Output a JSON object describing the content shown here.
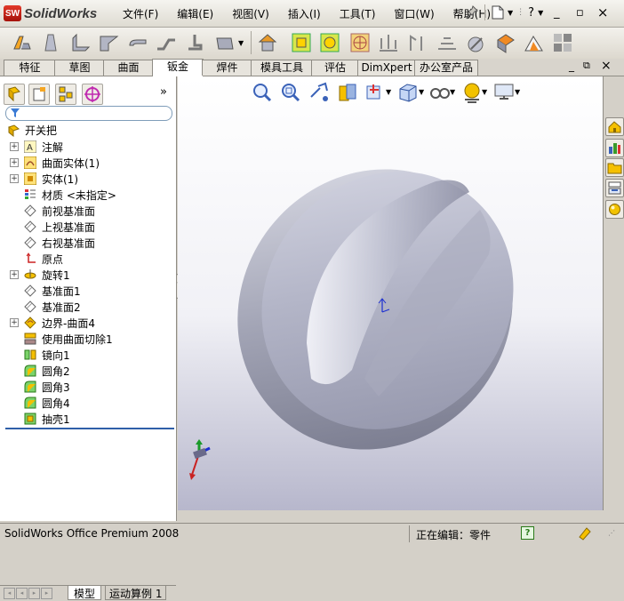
{
  "app": {
    "brand": "SolidWorks",
    "logo_text": "SW"
  },
  "menu": [
    "文件(F)",
    "编辑(E)",
    "视图(V)",
    "插入(I)",
    "工具(T)",
    "窗口(W)",
    "帮助(H)"
  ],
  "quick_access": {
    "help_glyph": "?"
  },
  "window_buttons": {
    "minimize": "_",
    "restore": "▫",
    "close": "×"
  },
  "command_tabs": [
    {
      "label": "特征"
    },
    {
      "label": "草图"
    },
    {
      "label": "曲面"
    },
    {
      "label": "钣金"
    },
    {
      "label": "焊件"
    },
    {
      "label": "模具工具"
    },
    {
      "label": "评估"
    },
    {
      "label": "DimXpert"
    },
    {
      "label": "办公室产品"
    }
  ],
  "active_tab": "钣金",
  "feature_tree": {
    "root": "开关把",
    "items": [
      {
        "label": "注解",
        "expandable": true,
        "icon": "annotation-icon"
      },
      {
        "label": "曲面实体(1)",
        "expandable": true,
        "icon": "surface-bodies-icon"
      },
      {
        "label": "实体(1)",
        "expandable": true,
        "icon": "solid-bodies-icon"
      },
      {
        "label": "材质 <未指定>",
        "expandable": false,
        "icon": "material-icon"
      },
      {
        "label": "前视基准面",
        "expandable": false,
        "icon": "plane-icon"
      },
      {
        "label": "上视基准面",
        "expandable": false,
        "icon": "plane-icon"
      },
      {
        "label": "右视基准面",
        "expandable": false,
        "icon": "plane-icon"
      },
      {
        "label": "原点",
        "expandable": false,
        "icon": "origin-icon"
      },
      {
        "label": "旋转1",
        "expandable": true,
        "icon": "revolve-icon"
      },
      {
        "label": "基准面1",
        "expandable": false,
        "icon": "plane-icon"
      },
      {
        "label": "基准面2",
        "expandable": false,
        "icon": "plane-icon"
      },
      {
        "label": "边界-曲面4",
        "expandable": true,
        "icon": "boundary-surface-icon"
      },
      {
        "label": "使用曲面切除1",
        "expandable": false,
        "icon": "surface-cut-icon"
      },
      {
        "label": "镜向1",
        "expandable": false,
        "icon": "mirror-icon"
      },
      {
        "label": "圆角2",
        "expandable": false,
        "icon": "fillet-icon"
      },
      {
        "label": "圆角3",
        "expandable": false,
        "icon": "fillet-icon"
      },
      {
        "label": "圆角4",
        "expandable": false,
        "icon": "fillet-icon"
      },
      {
        "label": "抽壳1",
        "expandable": false,
        "icon": "shell-icon"
      }
    ]
  },
  "panel": {
    "collapse_glyph": "»"
  },
  "bottom_tabs": {
    "model": "模型",
    "motion": "运动算例 1"
  },
  "status": {
    "product": "SolidWorks Office Premium 2008",
    "editing": "正在编辑：零件"
  },
  "colors": {
    "accent_blue": "#2f5fa8",
    "model_body": "#a9abb8",
    "brand_red": "#c0231a"
  }
}
